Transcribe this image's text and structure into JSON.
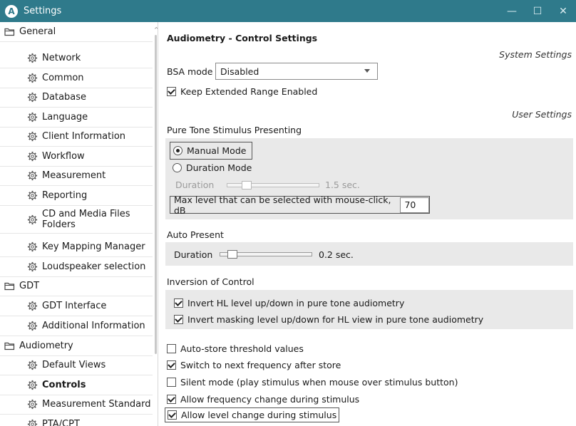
{
  "window": {
    "app_icon_letter": "A",
    "title": "Settings",
    "minimize_glyph": "—",
    "maximize_glyph": "☐",
    "close_glyph": "✕"
  },
  "sidebar": {
    "items": [
      {
        "label": "General",
        "type": "group",
        "icon": "folder-icon"
      },
      {
        "label": "Network",
        "type": "child",
        "icon": "gear-icon"
      },
      {
        "label": "Common",
        "type": "child",
        "icon": "gear-icon"
      },
      {
        "label": "Database",
        "type": "child",
        "icon": "gear-icon"
      },
      {
        "label": "Language",
        "type": "child",
        "icon": "gear-icon"
      },
      {
        "label": "Client Information",
        "type": "child",
        "icon": "gear-icon"
      },
      {
        "label": "Workflow",
        "type": "child",
        "icon": "gear-icon"
      },
      {
        "label": "Measurement",
        "type": "child",
        "icon": "gear-icon"
      },
      {
        "label": "Reporting",
        "type": "child",
        "icon": "gear-icon"
      },
      {
        "label": "CD and Media Files Folders",
        "type": "child",
        "icon": "gear-icon"
      },
      {
        "label": "Key Mapping Manager",
        "type": "child",
        "icon": "gear-icon"
      },
      {
        "label": "Loudspeaker selection",
        "type": "child",
        "icon": "gear-icon"
      },
      {
        "label": "GDT",
        "type": "group",
        "icon": "folder-icon"
      },
      {
        "label": "GDT Interface",
        "type": "child",
        "icon": "gear-icon"
      },
      {
        "label": "Additional Information",
        "type": "child",
        "icon": "gear-icon"
      },
      {
        "label": "Audiometry",
        "type": "group",
        "icon": "folder-icon"
      },
      {
        "label": "Default Views",
        "type": "child",
        "icon": "gear-icon"
      },
      {
        "label": "Controls",
        "type": "child",
        "icon": "gear-icon",
        "selected": true
      },
      {
        "label": "Measurement Standard",
        "type": "child",
        "icon": "gear-icon"
      },
      {
        "label": "PTA/CPT",
        "type": "child",
        "icon": "gear-icon"
      }
    ]
  },
  "main": {
    "title": "Audiometry - Control Settings",
    "system_settings_caption": "System Settings",
    "bsa_label": "BSA mode",
    "bsa_value": "Disabled",
    "keep_extended_range": {
      "label": "Keep Extended Range Enabled",
      "checked": true
    },
    "user_settings_caption": "User Settings",
    "pure_tone": {
      "heading": "Pure Tone Stimulus Presenting",
      "manual_mode": "Manual Mode",
      "duration_mode": "Duration Mode",
      "selected_mode": "Manual Mode",
      "duration_label": "Duration",
      "duration_value": "1.5 sec.",
      "max_level_label": "Max level that can be selected with mouse-click, dB",
      "max_level_value": "70"
    },
    "auto_present": {
      "heading": "Auto Present",
      "duration_label": "Duration",
      "duration_value": "0.2 sec."
    },
    "inversion": {
      "heading": "Inversion of Control",
      "invert_hl": {
        "label": "Invert HL level up/down in pure tone audiometry",
        "checked": true
      },
      "invert_masking": {
        "label": "Invert masking level up/down for HL view in pure tone audiometry",
        "checked": true
      }
    },
    "options": [
      {
        "label": "Auto-store threshold values",
        "checked": false
      },
      {
        "label": "Switch to next frequency after store",
        "checked": true
      },
      {
        "label": "Silent mode (play stimulus when mouse over stimulus button)",
        "checked": false
      },
      {
        "label": "Allow frequency change during stimulus",
        "checked": true
      },
      {
        "label": "Allow level change during stimulus",
        "checked": true
      }
    ]
  },
  "colors": {
    "titlebar": "#2f7a8b",
    "panel_gray": "#e9e9e9",
    "folder_stroke": "#444444"
  }
}
